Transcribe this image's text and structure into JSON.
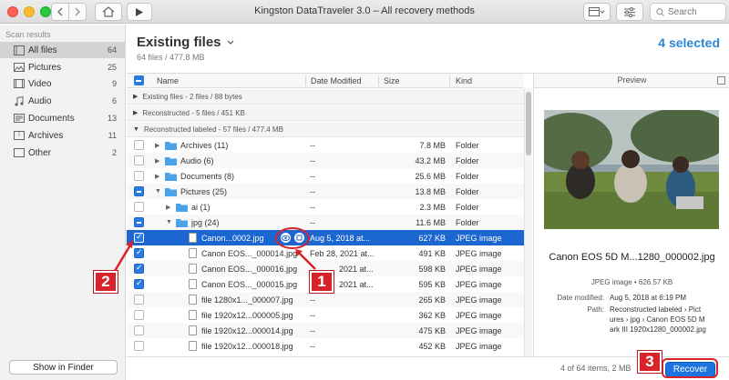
{
  "window": {
    "title": "Kingston DataTraveler 3.0 – All recovery methods",
    "search_placeholder": "Search"
  },
  "sidebar": {
    "heading": "Scan results",
    "items": [
      {
        "label": "All files",
        "count": "64",
        "icon": "files-icon",
        "selected": true
      },
      {
        "label": "Pictures",
        "count": "25",
        "icon": "picture-icon",
        "selected": false
      },
      {
        "label": "Video",
        "count": "9",
        "icon": "video-icon",
        "selected": false
      },
      {
        "label": "Audio",
        "count": "6",
        "icon": "music-note-icon",
        "selected": false
      },
      {
        "label": "Documents",
        "count": "13",
        "icon": "document-icon",
        "selected": false
      },
      {
        "label": "Archives",
        "count": "11",
        "icon": "archive-icon",
        "selected": false
      },
      {
        "label": "Other",
        "count": "2",
        "icon": "other-icon",
        "selected": false
      }
    ],
    "show_in_finder": "Show in Finder"
  },
  "main": {
    "title": "Existing files",
    "subtitle": "64 files / 477.8 MB",
    "selected_count": "4 selected"
  },
  "columns": {
    "name": "Name",
    "date": "Date Modified",
    "size": "Size",
    "kind": "Kind"
  },
  "groups": [
    "Existing files - 2 files / 88 bytes",
    "Reconstructed - 5 files / 451 KB",
    "Reconstructed labeled - 57 files / 477.4 MB"
  ],
  "rows": [
    {
      "name": "Archives (11)",
      "date": "--",
      "size": "7.8 MB",
      "kind": "Folder"
    },
    {
      "name": "Audio (6)",
      "date": "--",
      "size": "43.2 MB",
      "kind": "Folder"
    },
    {
      "name": "Documents (8)",
      "date": "--",
      "size": "25.6 MB",
      "kind": "Folder"
    },
    {
      "name": "Pictures (25)",
      "date": "--",
      "size": "13.8 MB",
      "kind": "Folder"
    },
    {
      "name": "ai (1)",
      "date": "--",
      "size": "2.3 MB",
      "kind": "Folder"
    },
    {
      "name": "jpg (24)",
      "date": "--",
      "size": "11.6 MB",
      "kind": "Folder"
    },
    {
      "name": "Canon...0002.jpg",
      "date": "Aug 5, 2018 at...",
      "size": "627 KB",
      "kind": "JPEG image"
    },
    {
      "name": "Canon EOS..._000014.jpg",
      "date": "Feb 28, 2021 at...",
      "size": "491 KB",
      "kind": "JPEG image"
    },
    {
      "name": "Canon EOS..._000016.jpg",
      "date": "2021 at...",
      "size": "598 KB",
      "kind": "JPEG image"
    },
    {
      "name": "Canon EOS..._000015.jpg",
      "date": "2021 at...",
      "size": "595 KB",
      "kind": "JPEG image"
    },
    {
      "name": "file 1280x1..._000007.jpg",
      "date": "--",
      "size": "265 KB",
      "kind": "JPEG image"
    },
    {
      "name": "file 1920x12...000005.jpg",
      "date": "--",
      "size": "362 KB",
      "kind": "JPEG image"
    },
    {
      "name": "file 1920x12...000014.jpg",
      "date": "--",
      "size": "475 KB",
      "kind": "JPEG image"
    },
    {
      "name": "file 1920x12...000018.jpg",
      "date": "--",
      "size": "452 KB",
      "kind": "JPEG image"
    }
  ],
  "preview": {
    "heading": "Preview",
    "file_name": "Canon EOS 5D M...1280_000002.jpg",
    "kind_size": "JPEG image • 626.57 KB",
    "date_label": "Date modified:",
    "date_value": "Aug 5, 2018 at 6:19 PM",
    "path_label": "Path:",
    "path_lines": [
      "Reconstructed labeled › Pict",
      "ures › jpg › Canon EOS 5D M",
      "ark III 1920x1280_000002.jpg"
    ]
  },
  "footer": {
    "status": "4 of 64 items, 2 MB",
    "recover": "Recover"
  },
  "callouts": [
    "1",
    "2",
    "3"
  ],
  "colors": {
    "accent": "#1d74e0",
    "selected_row": "#1c66d2",
    "callout_red": "#d8232a",
    "folder_blue": "#4aa3e8"
  }
}
